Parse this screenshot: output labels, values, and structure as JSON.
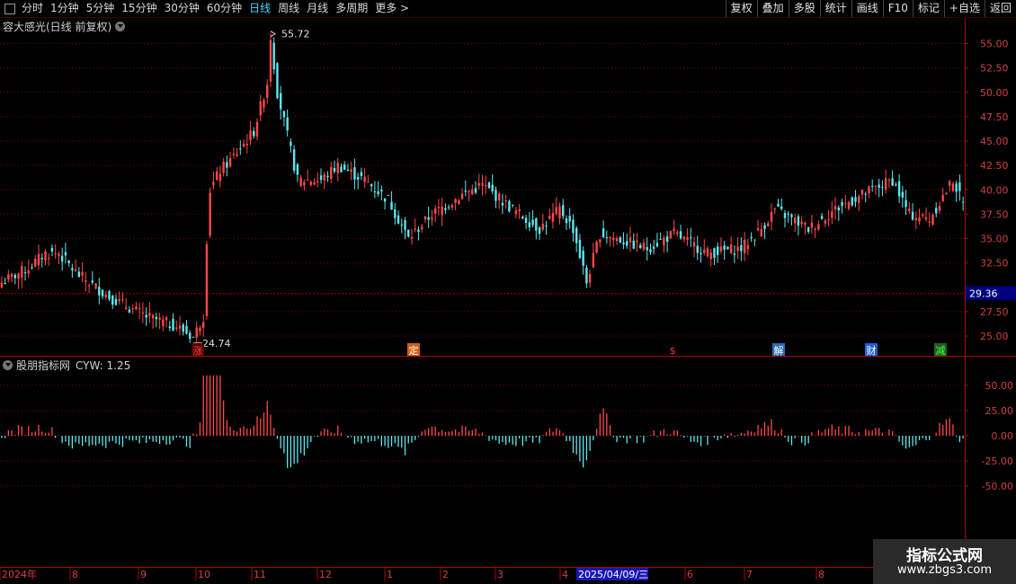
{
  "toolbar": {
    "periods": [
      "分时",
      "1分钟",
      "5分钟",
      "15分钟",
      "30分钟",
      "60分钟",
      "日线",
      "周线",
      "月线",
      "多周期",
      "更多 >"
    ],
    "active": "日线",
    "buttons": [
      "复权",
      "叠加",
      "多股",
      "统计",
      "画线",
      "F10",
      "标记",
      "+自选",
      "返回"
    ]
  },
  "main_chart": {
    "title": "容大感光(日线 前复权)",
    "high_label": "55.72",
    "low_label": "24.74",
    "current_price": "29.36",
    "y_ticks": [
      "55.00",
      "52.50",
      "50.00",
      "47.50",
      "45.00",
      "42.50",
      "40.00",
      "37.50",
      "35.00",
      "32.50",
      "27.50",
      "25.00"
    ],
    "markers": [
      {
        "text": "涨",
        "color": "#ff4040",
        "bg": "#500000"
      },
      {
        "text": "定",
        "color": "#ffffff",
        "bg": "#d06010"
      },
      {
        "text": "$",
        "color": "#ff3030",
        "bg": "#000000"
      },
      {
        "text": "解",
        "color": "#ffffff",
        "bg": "#2a6ab0"
      },
      {
        "text": "财",
        "color": "#ffffff",
        "bg": "#2060d0"
      },
      {
        "text": "减",
        "color": "#40ff40",
        "bg": "#206020"
      }
    ]
  },
  "indicator": {
    "title": "股朋指标网",
    "value_label": "CYW: 1.25",
    "y_ticks": [
      "50.00",
      "25.00",
      "0.00",
      "-25.00",
      "-50.00"
    ]
  },
  "time_axis": {
    "labels": [
      "2024年",
      "8",
      "9",
      "10",
      "11",
      "12",
      "1",
      "2",
      "3",
      "4",
      "2025/04/09/三",
      "6",
      "7",
      "8"
    ]
  },
  "watermark": {
    "line1": "指标公式网",
    "line2": "www.zbgs3.com"
  },
  "colors": {
    "up": "#ff4848",
    "down": "#5ce8f0",
    "grid": "#7a0000",
    "axis": "#b00000",
    "price_tag": "#000080"
  }
}
